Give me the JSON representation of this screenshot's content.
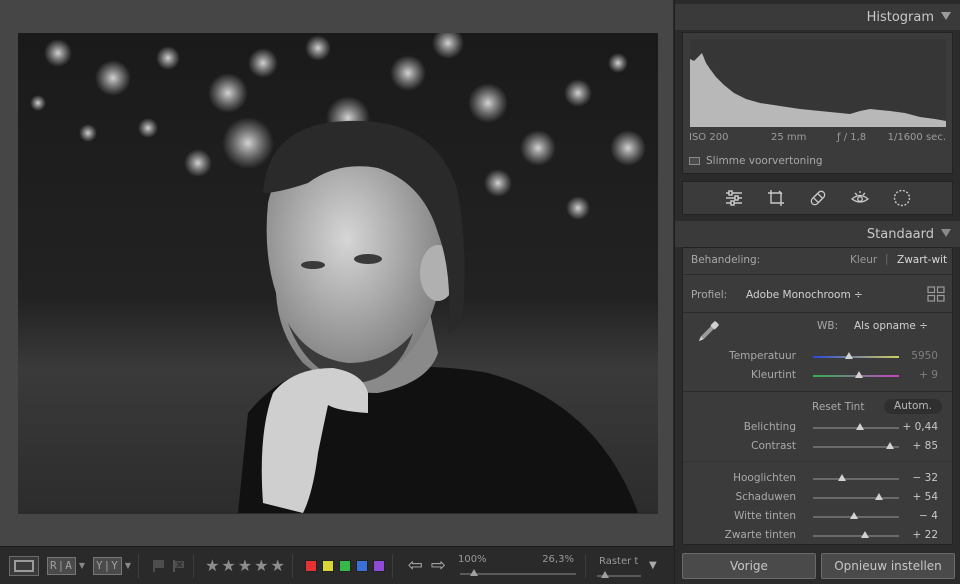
{
  "viewer": {
    "photo_description_icon": "portrait-photo"
  },
  "toolbar": {
    "view_mode_icon": "loupe-view-icon",
    "before_after_label": "R|A",
    "yy_label": "Y|Y",
    "stars": [
      "★",
      "★",
      "★",
      "★",
      "★"
    ],
    "swatches": [
      "#e53333",
      "#d8d636",
      "#36b84a",
      "#3a6fd8",
      "#8f4ad8"
    ],
    "zoom_fit_label": "100%",
    "zoom_value": "26,3%",
    "raster_label": "Raster t",
    "zoom_level_fraction": 0.12,
    "raster_level_fraction": 0.1
  },
  "histogram": {
    "title": "Histogram",
    "exif": {
      "iso": "ISO 200",
      "focal": "25 mm",
      "aperture": "ƒ / 1,8",
      "shutter": "1/1600 sec."
    },
    "smart_preview_label": "Slimme voorvertoning"
  },
  "tools": [
    "sliders-icon",
    "crop-icon",
    "healing-bandage-icon",
    "red-eye-icon",
    "mask-circle-icon"
  ],
  "basic": {
    "title": "Standaard",
    "treatment_label": "Behandeling:",
    "treatment_color": "Kleur",
    "treatment_bw": "Zwart-wit",
    "profile_label": "Profiel:",
    "profile_value": "Adobe Monochroom ÷",
    "wb_label": "WB:",
    "wb_value": "Als opname ÷",
    "temp": {
      "label": "Temperatuur",
      "value": "5950",
      "level": 0.42
    },
    "tint": {
      "label": "Kleurtint",
      "value": "+ 9",
      "level": 0.53
    },
    "reset_tint": "Reset Tint",
    "auto": "Autom.",
    "exposure": {
      "label": "Belichting",
      "value": "+ 0,44",
      "level": 0.55
    },
    "contrast": {
      "label": "Contrast",
      "value": "+ 85",
      "level": 0.9
    },
    "highlights": {
      "label": "Hooglichten",
      "value": "− 32",
      "level": 0.34
    },
    "shadows": {
      "label": "Schaduwen",
      "value": "+ 54",
      "level": 0.77
    },
    "whites": {
      "label": "Witte tinten",
      "value": "− 4",
      "level": 0.48
    },
    "blacks": {
      "label": "Zwarte tinten",
      "value": "+ 22",
      "level": 0.61
    }
  },
  "buttons": {
    "previous": "Vorige",
    "reset": "Opnieuw instellen"
  }
}
